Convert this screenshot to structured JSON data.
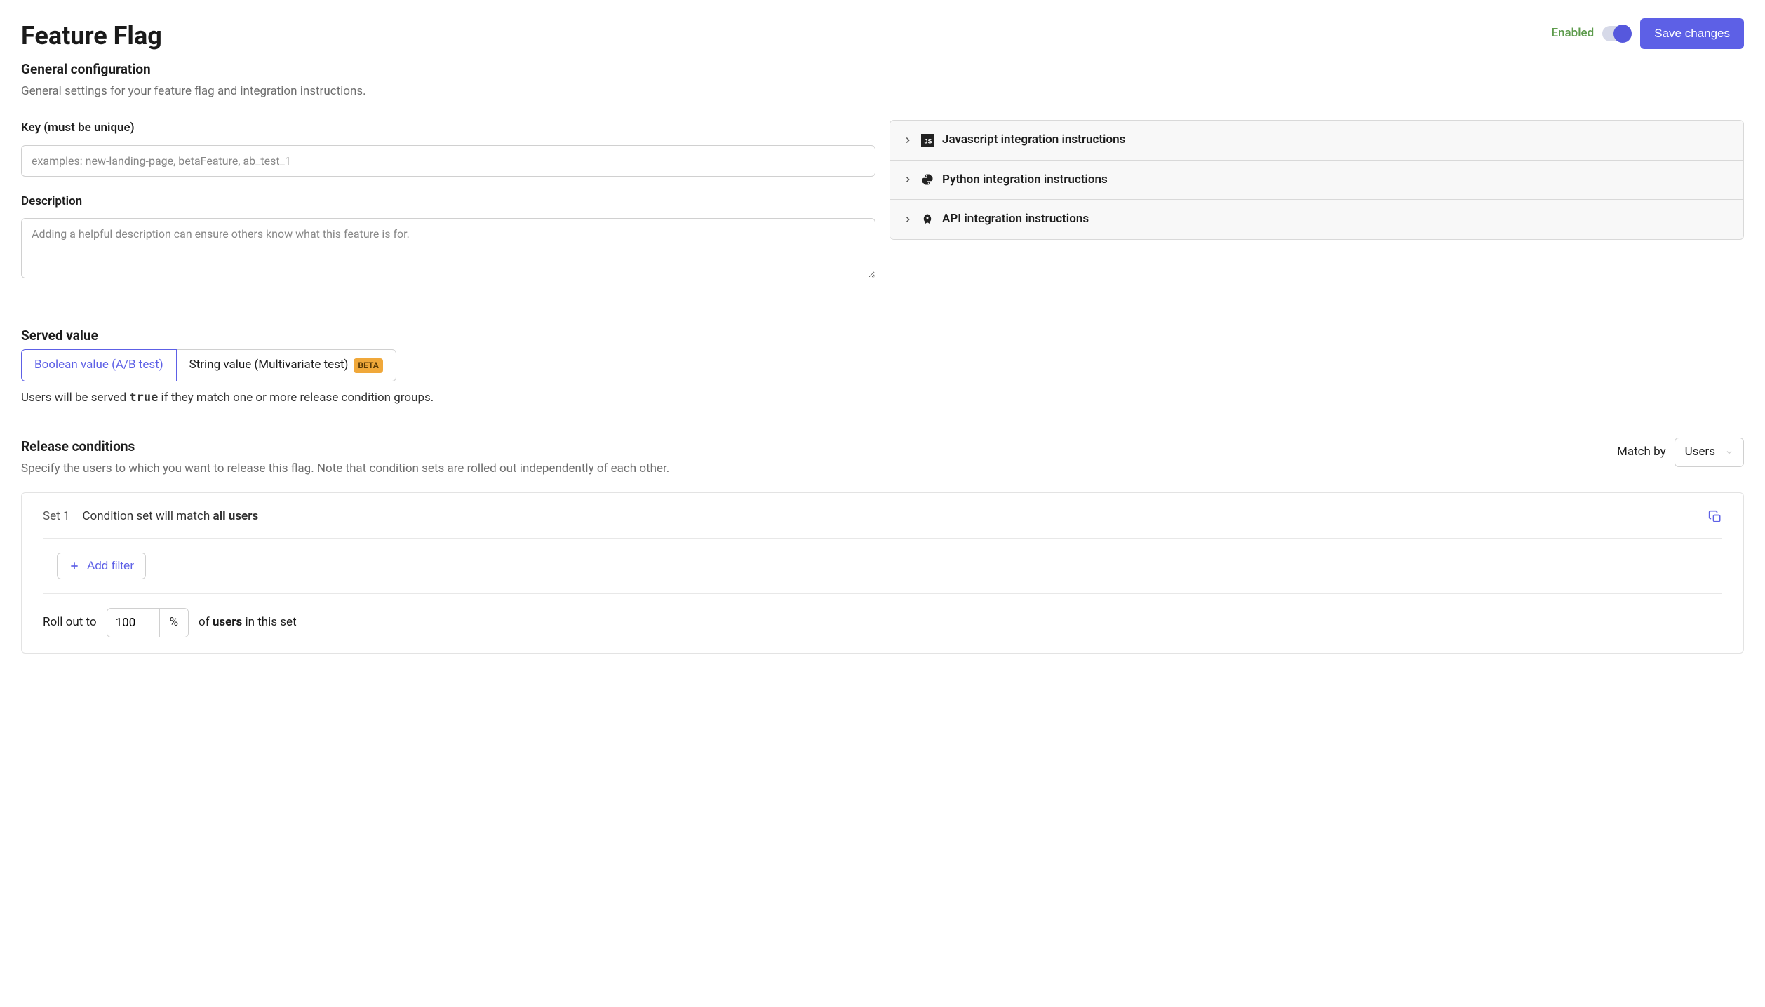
{
  "header": {
    "title": "Feature Flag",
    "enabled_label": "Enabled",
    "save_label": "Save changes"
  },
  "general": {
    "title": "General configuration",
    "desc": "General settings for your feature flag and integration instructions.",
    "key_label": "Key (must be unique)",
    "key_placeholder": "examples: new-landing-page, betaFeature, ab_test_1",
    "key_value": "",
    "description_label": "Description",
    "description_placeholder": "Adding a helpful description can ensure others know what this feature is for.",
    "description_value": ""
  },
  "integrations": [
    {
      "icon": "js",
      "label": "Javascript integration instructions"
    },
    {
      "icon": "python",
      "label": "Python integration instructions"
    },
    {
      "icon": "api",
      "label": "API integration instructions"
    }
  ],
  "served": {
    "title": "Served value",
    "tab_boolean": "Boolean value (A/B test)",
    "tab_string": "String value (Multivariate test)",
    "beta_label": "BETA",
    "desc_prefix": "Users will be served ",
    "desc_code": "true",
    "desc_suffix": " if they match one or more release condition groups."
  },
  "release": {
    "title": "Release conditions",
    "desc": "Specify the users to which you want to release this flag. Note that condition sets are rolled out independently of each other.",
    "match_by_label": "Match by",
    "match_by_value": "Users",
    "set": {
      "label": "Set 1",
      "desc_prefix": "Condition set will match ",
      "desc_strong": "all users",
      "add_filter_label": "Add filter",
      "rollout_prefix": "Roll out to",
      "rollout_value": "100",
      "rollout_suffix": "%",
      "rollout_after_prefix": "of ",
      "rollout_after_strong": "users",
      "rollout_after_suffix": " in this set"
    }
  }
}
